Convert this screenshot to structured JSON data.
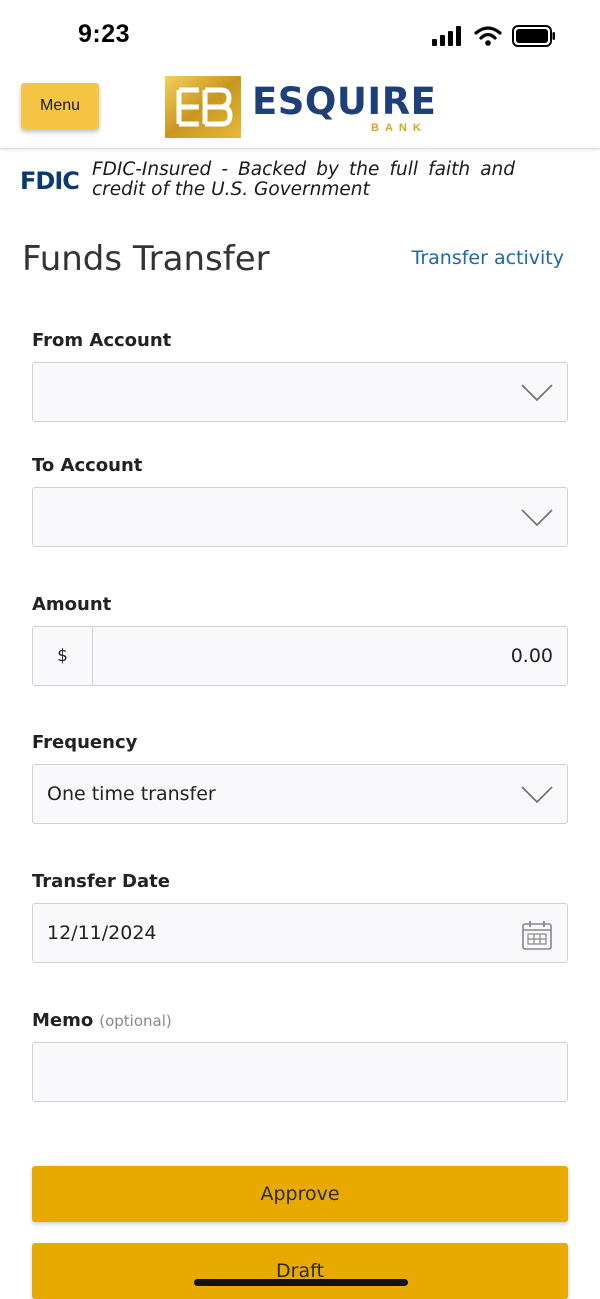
{
  "status_bar": {
    "time": "9:23",
    "icons": [
      "signal-icon",
      "wifi-icon",
      "battery-icon"
    ]
  },
  "header": {
    "menu_label": "Menu",
    "logo_name": "ESQUIRE",
    "logo_sub": "BANK",
    "colors": {
      "menu": "#f6c544",
      "brand_blue": "#1f3f78",
      "brand_gold": "#d7a51f"
    }
  },
  "fdic": {
    "logo": "FDIC",
    "text": "FDIC-Insured - Backed by the full faith and credit of the U.S. Government"
  },
  "page": {
    "title": "Funds Transfer",
    "activity_link": "Transfer activity"
  },
  "form": {
    "from_account": {
      "label": "From Account",
      "value": ""
    },
    "to_account": {
      "label": "To Account",
      "value": ""
    },
    "amount": {
      "label": "Amount",
      "currency": "$",
      "value": "0.00"
    },
    "frequency": {
      "label": "Frequency",
      "value": "One time transfer"
    },
    "transfer_date": {
      "label": "Transfer Date",
      "value": "12/11/2024"
    },
    "memo": {
      "label": "Memo",
      "optional": "(optional)",
      "value": ""
    }
  },
  "actions": {
    "approve": "Approve",
    "draft": "Draft",
    "color": "#e9aa00"
  }
}
